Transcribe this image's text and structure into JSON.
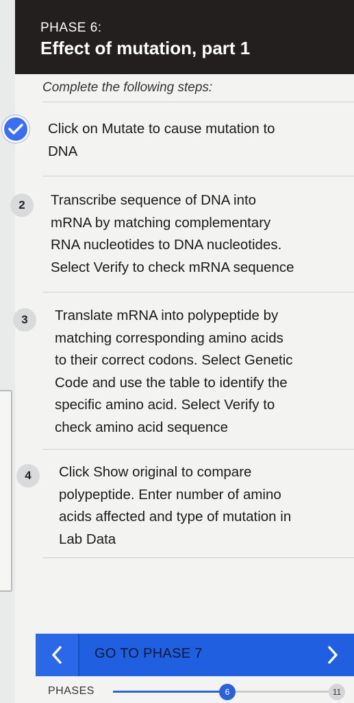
{
  "header": {
    "phase_label": "PHASE 6:",
    "title": "Effect of mutation, part 1"
  },
  "instructions": "Complete the following steps:",
  "steps": [
    {
      "badge": "",
      "status": "complete",
      "icon": "check-icon",
      "text": "Click on Mutate to cause mutation to\nDNA"
    },
    {
      "badge": "2",
      "status": "pending",
      "text": "Transcribe sequence of DNA into\nmRNA by matching complementary\nRNA nucleotides to DNA nucleotides.\nSelect Verify to check mRNA sequence"
    },
    {
      "badge": "3",
      "status": "pending",
      "text": "Translate mRNA into polypeptide by\nmatching corresponding amino acids\nto their correct codons. Select Genetic\nCode and use the table to identify the\nspecific amino acid. Select Verify to\ncheck amino acid sequence"
    },
    {
      "badge": "4",
      "status": "pending",
      "text": "Click Show original to compare\npolypeptide. Enter number of amino\nacids affected and type of mutation in\nLab Data"
    }
  ],
  "nav": {
    "label": "GO TO PHASE 7",
    "prev_icon": "chevron-left-icon",
    "next_icon": "chevron-right-icon"
  },
  "phases": {
    "label": "PHASES",
    "current": "6",
    "total": "11",
    "progress_fraction": 0.5
  },
  "colors": {
    "header_bg": "#231f1f",
    "accent": "#1f5fe0",
    "check_badge": "#3b6ef0"
  }
}
